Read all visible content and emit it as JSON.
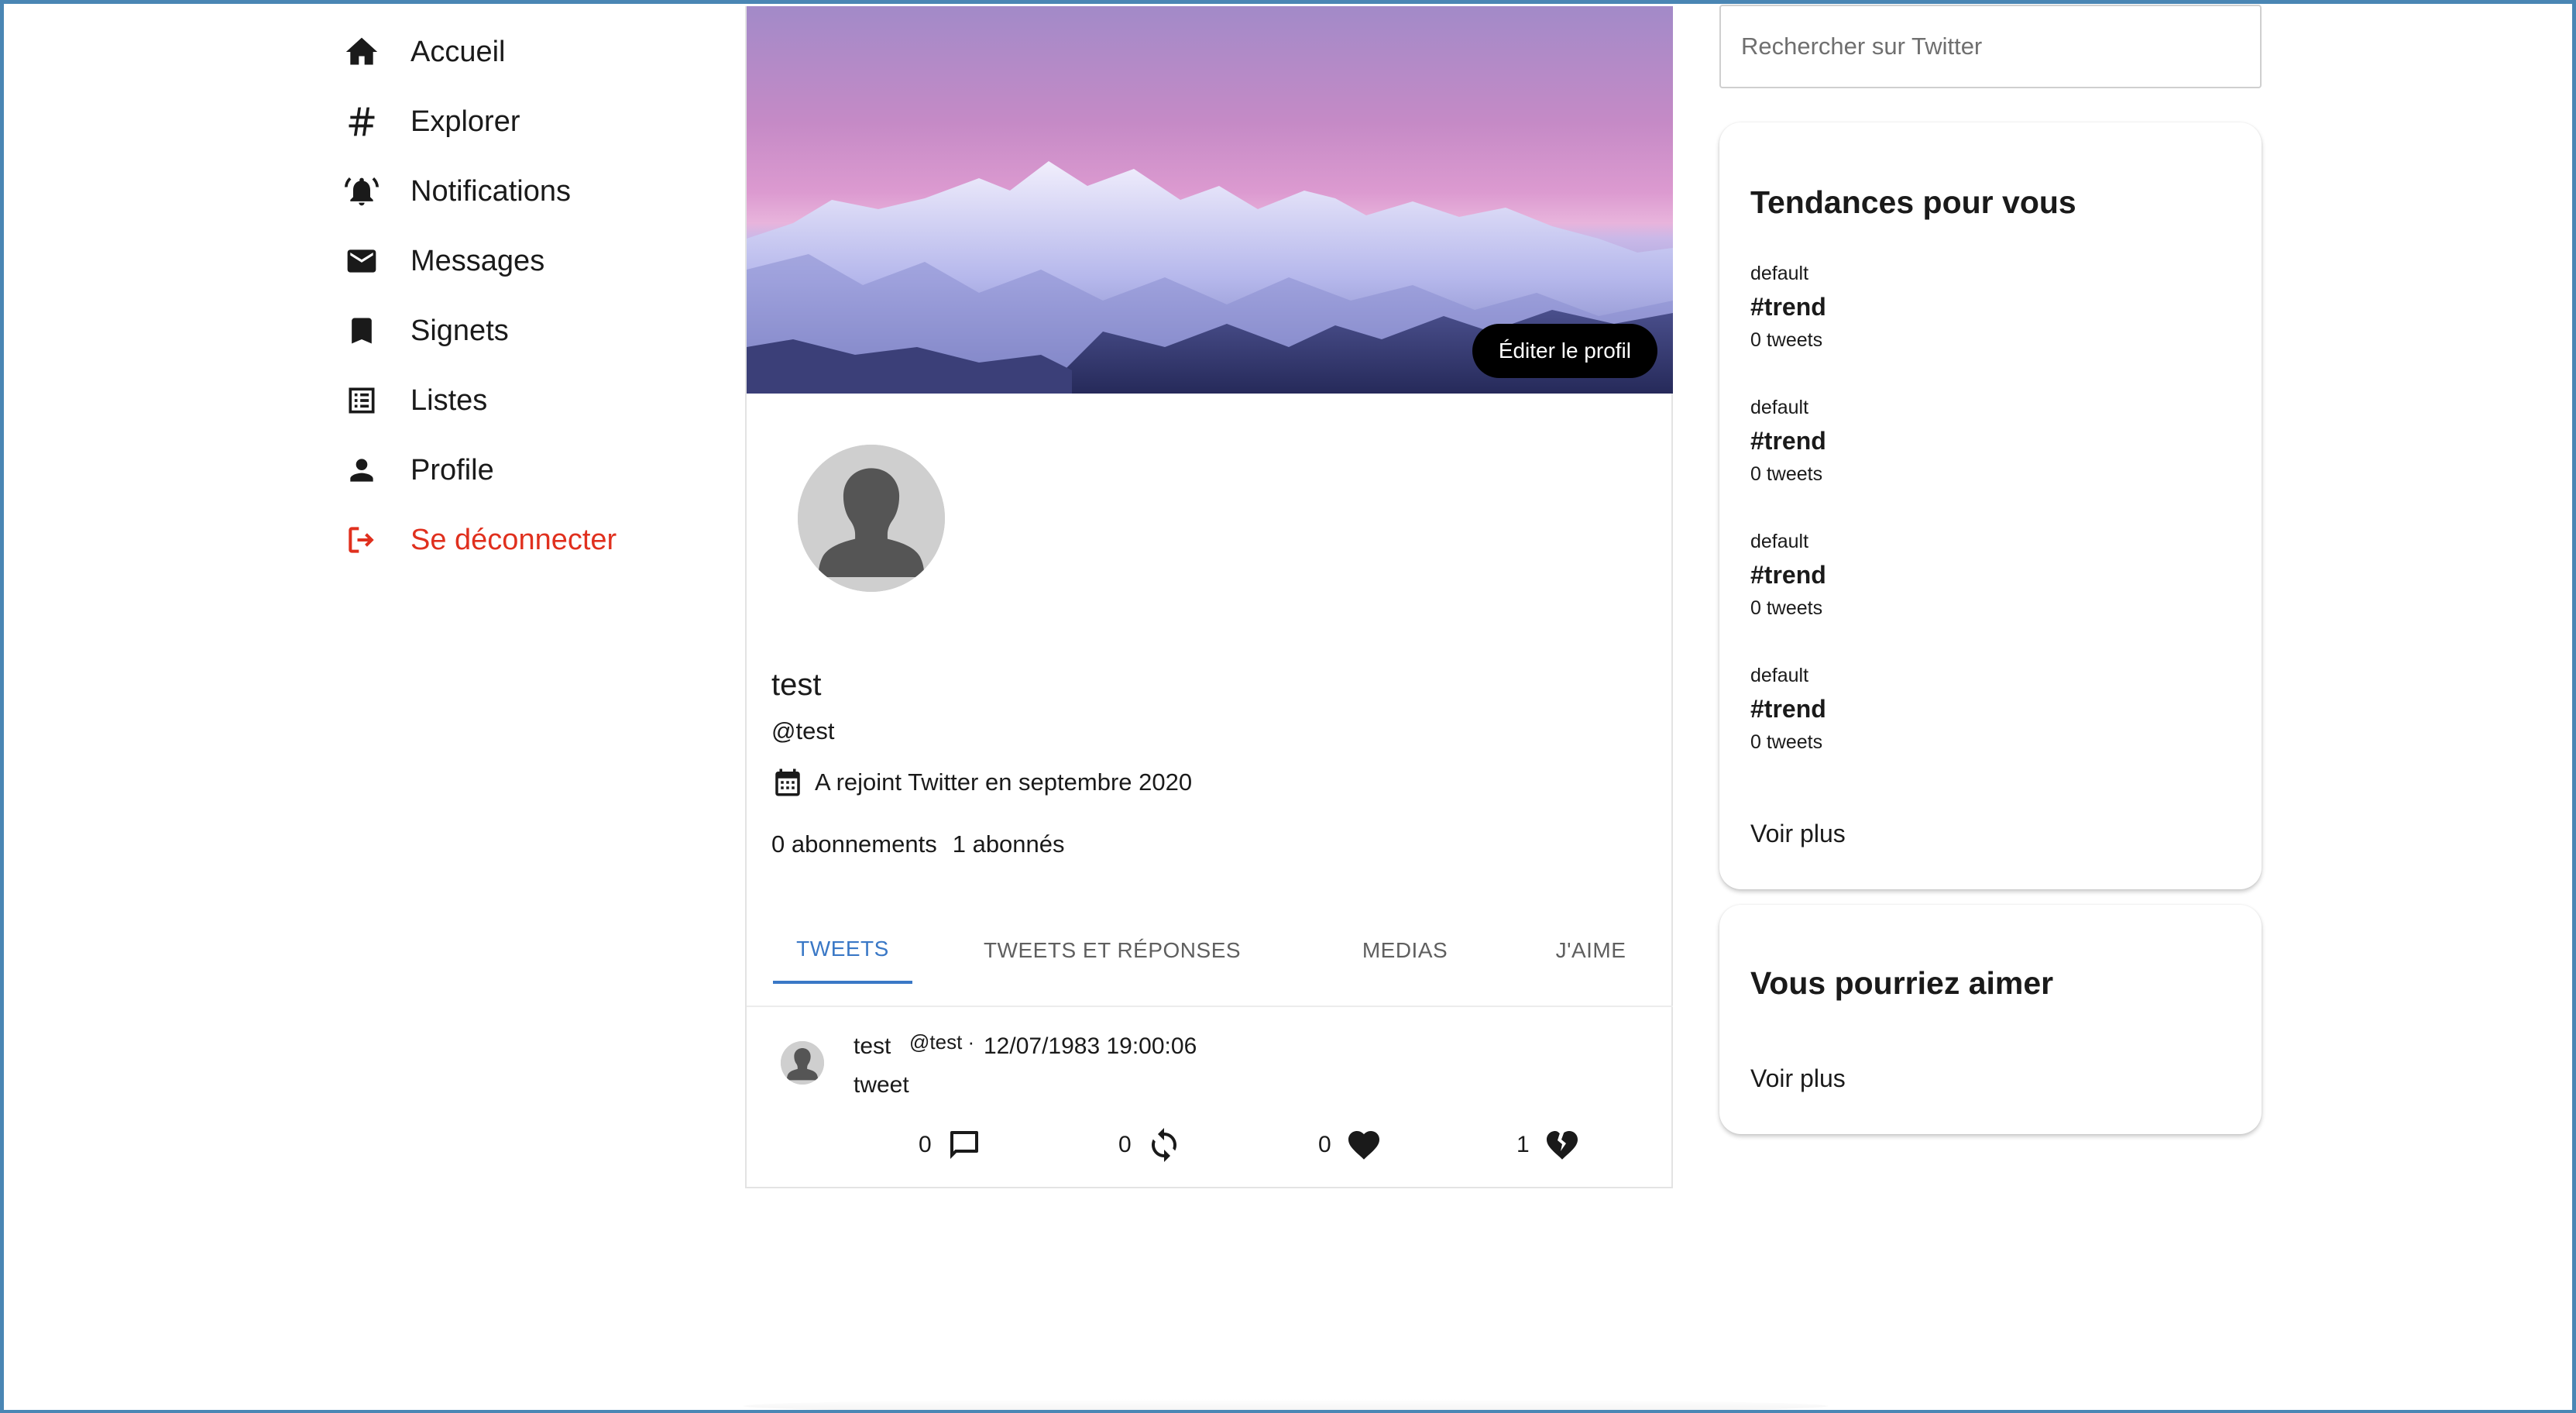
{
  "nav": {
    "items": [
      {
        "label": "Accueil",
        "icon": "home-icon"
      },
      {
        "label": "Explorer",
        "icon": "hashtag-icon"
      },
      {
        "label": "Notifications",
        "icon": "bell-icon"
      },
      {
        "label": "Messages",
        "icon": "envelope-icon"
      },
      {
        "label": "Signets",
        "icon": "bookmark-icon"
      },
      {
        "label": "Listes",
        "icon": "list-icon"
      },
      {
        "label": "Profile",
        "icon": "person-icon"
      },
      {
        "label": "Se déconnecter",
        "icon": "logout-icon"
      }
    ],
    "logout_color": "#e0301e"
  },
  "profile": {
    "edit_button": "Éditer le profil",
    "name": "test",
    "handle": "@test",
    "joined": "A rejoint Twitter en septembre 2020",
    "following": "0 abonnements",
    "followers": "1 abonnés"
  },
  "tabs": [
    {
      "label": "TWEETS",
      "active": true
    },
    {
      "label": "TWEETS ET RÉPONSES",
      "active": false
    },
    {
      "label": "MEDIAS",
      "active": false
    },
    {
      "label": "J'AIME",
      "active": false
    }
  ],
  "accent_color": "#3a78c6",
  "tweet": {
    "name": "test",
    "handle": "@test ·",
    "date": "12/07/1983 19:00:06",
    "text": "tweet",
    "replies": "0",
    "retweets": "0",
    "likes": "0",
    "dislikes": "1"
  },
  "search": {
    "placeholder": "Rechercher sur Twitter"
  },
  "trends_card": {
    "title": "Tendances pour vous",
    "items": [
      {
        "category": "default",
        "tag": "#trend",
        "count": "0 tweets"
      },
      {
        "category": "default",
        "tag": "#trend",
        "count": "0 tweets"
      },
      {
        "category": "default",
        "tag": "#trend",
        "count": "0 tweets"
      },
      {
        "category": "default",
        "tag": "#trend",
        "count": "0 tweets"
      }
    ],
    "more": "Voir plus"
  },
  "suggest_card": {
    "title": "Vous pourriez aimer",
    "more": "Voir plus"
  }
}
